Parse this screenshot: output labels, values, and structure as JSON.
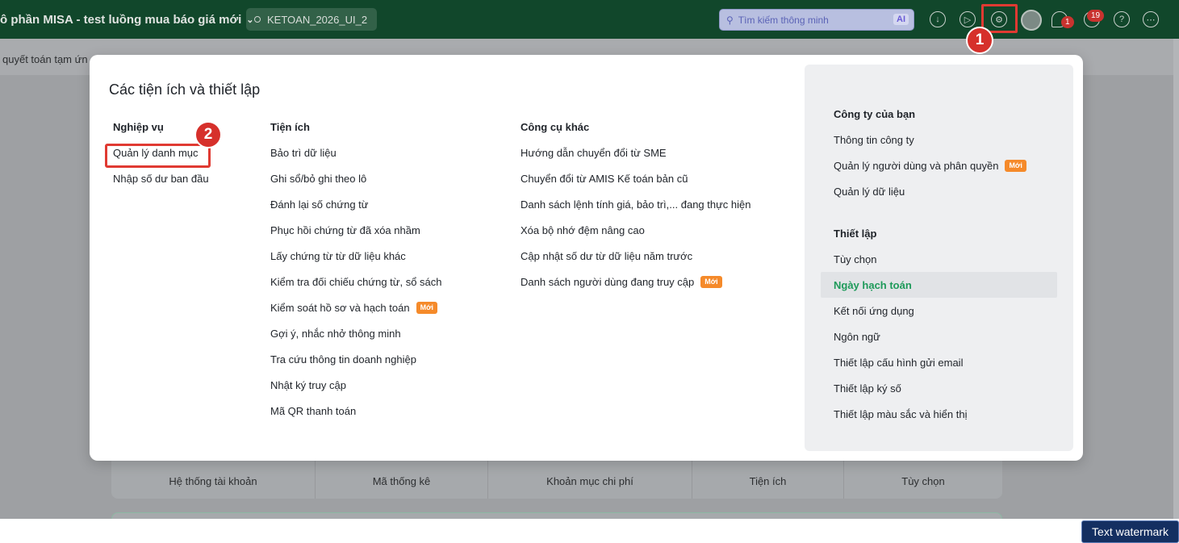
{
  "topbar": {
    "company_name": "ô phần MISA - test luồng mua báo giá mới",
    "database": "KETOAN_2026_UI_2",
    "search_placeholder": "Tìm kiếm thông minh",
    "search_ai_label": "AI",
    "notification_count": "1",
    "alert_count": "19"
  },
  "subbar": {
    "text": "quyết toán tạm ứn"
  },
  "modal": {
    "title": "Các tiện ích và thiết lập",
    "columns": [
      {
        "heading": "Nghiệp vụ",
        "items": [
          {
            "label": "Quản lý danh mục"
          },
          {
            "label": "Nhập số dư ban đầu"
          }
        ]
      },
      {
        "heading": "Tiện ích",
        "items": [
          {
            "label": "Bảo trì dữ liệu"
          },
          {
            "label": "Ghi sổ/bỏ ghi theo lô"
          },
          {
            "label": "Đánh lại số chứng từ"
          },
          {
            "label": "Phục hồi chứng từ đã xóa nhầm"
          },
          {
            "label": "Lấy chứng từ từ dữ liệu khác"
          },
          {
            "label": "Kiểm tra đối chiếu chứng từ, sổ sách"
          },
          {
            "label": "Kiểm soát hồ sơ và hạch toán",
            "tag": "Mới"
          },
          {
            "label": "Gợi ý, nhắc nhở thông minh"
          },
          {
            "label": "Tra cứu thông tin doanh nghiệp"
          },
          {
            "label": "Nhật ký truy cập"
          },
          {
            "label": "Mã QR thanh toán"
          }
        ]
      },
      {
        "heading": "Công cụ khác",
        "items": [
          {
            "label": "Hướng dẫn chuyển đổi từ SME"
          },
          {
            "label": "Chuyển đổi từ AMIS Kế toán bản cũ"
          },
          {
            "label": "Danh sách lệnh tính giá, bảo trì,... đang thực hiện"
          },
          {
            "label": "Xóa bộ nhớ đệm nâng cao"
          },
          {
            "label": "Cập nhật số dư từ dữ liệu năm trước"
          },
          {
            "label": "Danh sách người dùng đang truy cập",
            "tag": "Mới"
          }
        ]
      }
    ],
    "right_panel": {
      "company": {
        "heading": "Công ty của bạn",
        "items": [
          {
            "label": "Thông tin công ty"
          },
          {
            "label": "Quản lý người dùng và phân quyền",
            "tag": "Mới"
          },
          {
            "label": "Quản lý dữ liệu"
          }
        ]
      },
      "settings": {
        "heading": "Thiết lập",
        "items": [
          {
            "label": "Tùy chọn"
          },
          {
            "label": "Ngày hạch toán",
            "active": true
          },
          {
            "label": "Kết nối ứng dụng"
          },
          {
            "label": "Ngôn ngữ"
          },
          {
            "label": "Thiết lập cấu hình gửi email"
          },
          {
            "label": "Thiết lập ký số"
          },
          {
            "label": "Thiết lập màu sắc và hiển thị"
          }
        ]
      }
    }
  },
  "dashboard_shortcuts": [
    {
      "label": "Hệ thống tài khoản"
    },
    {
      "label": "Mã thống kê"
    },
    {
      "label": "Khoản mục chi phí"
    },
    {
      "label": "Tiện ích"
    },
    {
      "label": "Tùy chọn"
    }
  ],
  "annotations": {
    "step1": "1",
    "step2": "2"
  },
  "watermark": "Text watermark",
  "colors": {
    "brand_green": "#1e7a4a",
    "active_green": "#1e9a5a",
    "new_tag": "#f58a2a",
    "highlight_red": "#e03a32"
  }
}
